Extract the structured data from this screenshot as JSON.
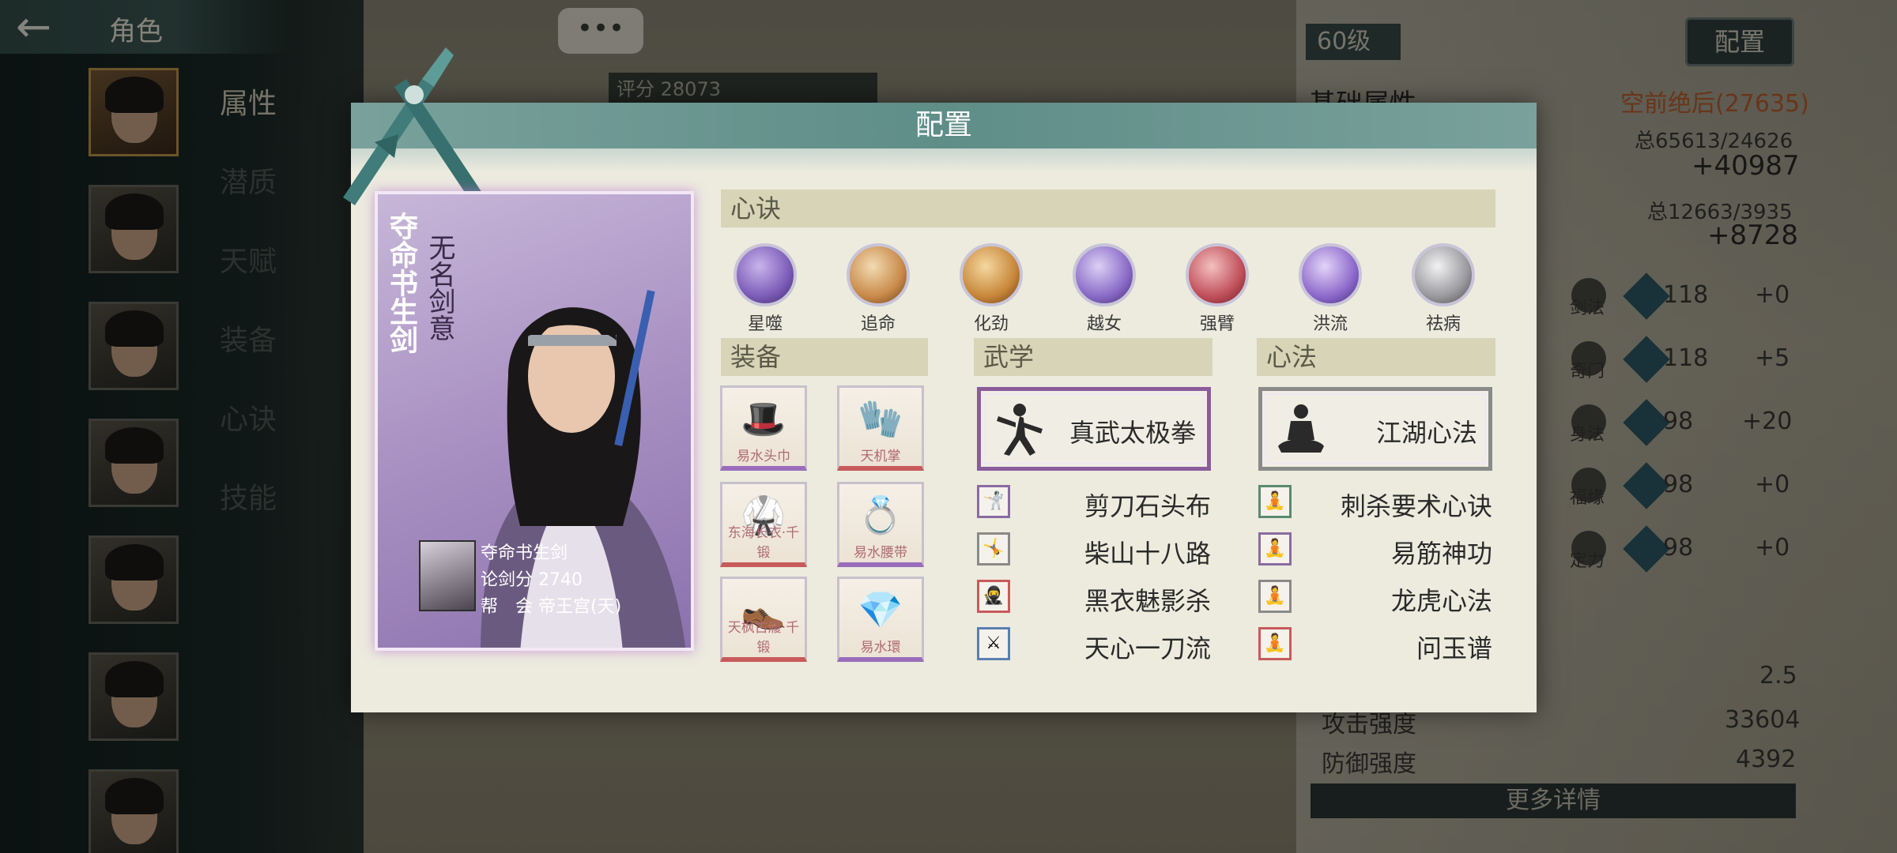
{
  "header": {
    "back_label": "←",
    "title": "角色",
    "more_label": "•••"
  },
  "sidebar": {
    "tabs": [
      {
        "label": "属性",
        "active": true
      },
      {
        "label": "潜质",
        "active": false
      },
      {
        "label": "天赋",
        "active": false
      },
      {
        "label": "装备",
        "active": false
      },
      {
        "label": "心诀",
        "active": false
      },
      {
        "label": "技能",
        "active": false
      }
    ]
  },
  "background": {
    "score_label": "评分",
    "score_value": "28073",
    "level": "60级",
    "config_button": "配置",
    "basic_attr_label": "基础属性",
    "rank_text": "空前绝后(27635)",
    "total1": "总65613/24626",
    "plus1": "+40987",
    "total2": "总12663/3935",
    "plus2": "+8728",
    "stats": [
      {
        "name": "剑法",
        "value": "118",
        "delta": "+0"
      },
      {
        "name": "奇门",
        "value": "118",
        "delta": "+5"
      },
      {
        "name": "身法",
        "value": "98",
        "delta": "+20"
      },
      {
        "name": "福缘",
        "value": "98",
        "delta": "+0"
      },
      {
        "name": "定力",
        "value": "98",
        "delta": "+0"
      }
    ],
    "val_a": "2.5",
    "attack_label": "攻击强度",
    "attack_value": "33604",
    "defense_label": "防御强度",
    "defense_value": "4392",
    "more_details": "更多详情"
  },
  "modal": {
    "title": "配置",
    "card": {
      "title_main": "夺命书生剑",
      "title_sub": "无名剑意",
      "name": "夺命书生剑",
      "score_label": "论剑分",
      "score": "2740",
      "guild_label": "帮　会",
      "guild": "帝王宫(天)"
    },
    "xinjue_header": "心诀",
    "xinjue": [
      {
        "label": "星噬",
        "color": "#7c5cb8"
      },
      {
        "label": "追命",
        "color": "#c98a4a"
      },
      {
        "label": "化劲",
        "color": "#c8873a"
      },
      {
        "label": "越女",
        "color": "#8a6bc8"
      },
      {
        "label": "强臂",
        "color": "#c0505a"
      },
      {
        "label": "洪流",
        "color": "#8d6acb"
      },
      {
        "label": "祛病",
        "color": "#9a9a9e"
      }
    ],
    "equip_header": "装备",
    "equipment": [
      {
        "name": "易水头巾",
        "glyph": "🎩",
        "rarity": "purple"
      },
      {
        "name": "天机掌",
        "glyph": "🧤",
        "rarity": "red"
      },
      {
        "name": "东海长衣·千锻",
        "glyph": "🥋",
        "rarity": "red"
      },
      {
        "name": "易水腰带",
        "glyph": "💍",
        "rarity": "purple"
      },
      {
        "name": "天枫古履·千锻",
        "glyph": "👞",
        "rarity": "red"
      },
      {
        "name": "易水環",
        "glyph": "💎",
        "rarity": "purple"
      }
    ],
    "wuxue_header": "武学",
    "wuxue_main": "真武太极拳",
    "wuxue_list": [
      {
        "name": "剪刀石头布",
        "frame": "purple"
      },
      {
        "name": "柴山十八路",
        "frame": "gray"
      },
      {
        "name": "黑衣魅影杀",
        "frame": "red"
      },
      {
        "name": "天心一刀流",
        "frame": "blue"
      }
    ],
    "xinfa_header": "心法",
    "xinfa_main": "江湖心法",
    "xinfa_list": [
      {
        "name": "刺杀要术心诀",
        "frame": "green"
      },
      {
        "name": "易筋神功",
        "frame": "purple"
      },
      {
        "name": "龙虎心法",
        "frame": "gray"
      },
      {
        "name": "问玉谱",
        "frame": "red"
      }
    ]
  }
}
